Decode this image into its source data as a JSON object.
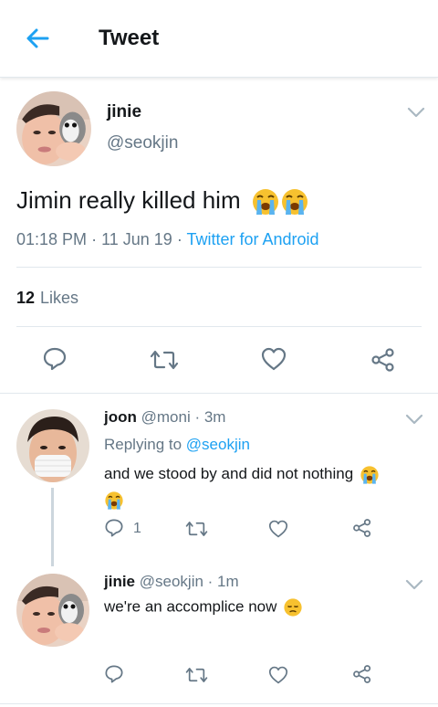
{
  "header": {
    "title": "Tweet"
  },
  "main_tweet": {
    "name": "jinie",
    "handle": "@seokjin",
    "text": "Jimin really killed him",
    "time": "01:18 PM",
    "date": "11 Jun 19",
    "source": "Twitter for Android",
    "likes_count": "12",
    "likes_label": "Likes"
  },
  "replies": [
    {
      "name": "joon",
      "handle": "@moni",
      "time": "3m",
      "replying_label": "Replying to",
      "replying_to": "@seokjin",
      "text": "and we stood by and did not nothing",
      "reply_count": "1"
    },
    {
      "name": "jinie",
      "handle": "@seokjin",
      "time": "1m",
      "text": "we're an accomplice now"
    }
  ],
  "colors": {
    "accent": "#1da1f2",
    "secondary_text": "#657786",
    "divider": "#e1e8ed"
  },
  "icons": [
    "back-arrow-icon",
    "chevron-down-icon",
    "reply-icon",
    "retweet-icon",
    "like-heart-icon",
    "share-icon",
    "crying-face-emoji",
    "pensive-face-emoji"
  ]
}
